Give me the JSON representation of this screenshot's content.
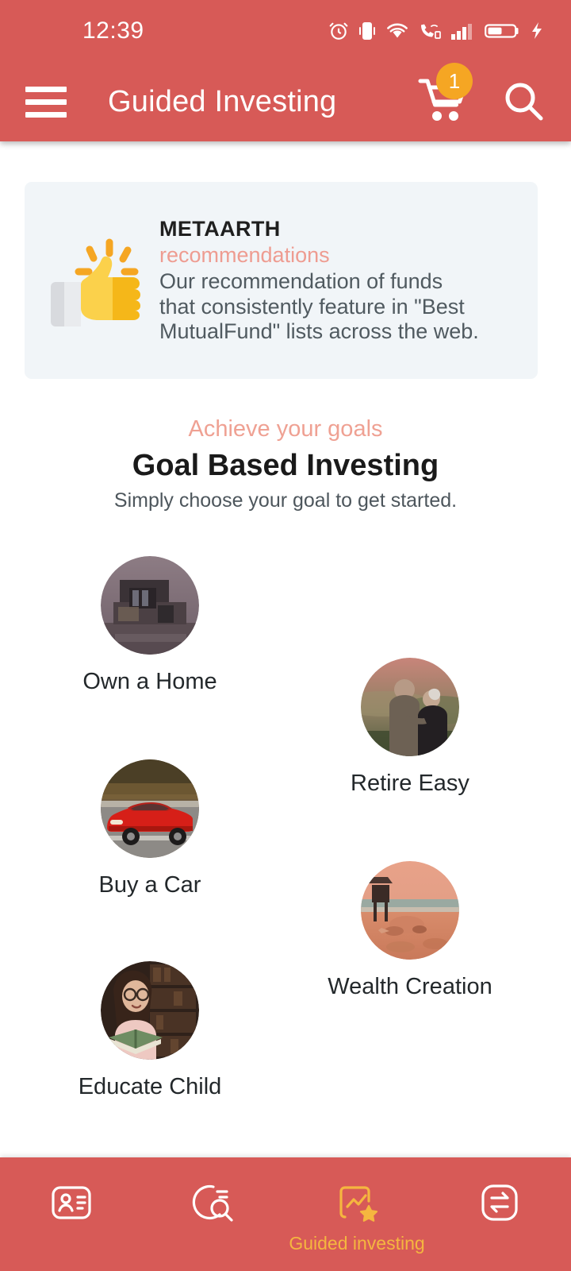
{
  "statusbar": {
    "time": "12:39",
    "icons": [
      "alarm-icon",
      "vibrate-icon",
      "wifi-icon",
      "wifi-calling-icon",
      "signal-bars-icon",
      "battery-icon",
      "charging-bolt-icon"
    ]
  },
  "appbar": {
    "menu_icon": "hamburger-menu-icon",
    "title": "Guided Investing",
    "cart_icon": "shopping-cart-icon",
    "cart_badge": "1",
    "search_icon": "search-icon",
    "background_color": "#d75a57"
  },
  "recommendation_card": {
    "icon": "thumbs-up-icon",
    "brand": "METAARTH",
    "subtitle": "recommendations",
    "description_lines": [
      "Our recommendation of funds",
      "that consistently feature in \"Best",
      "MutualFund\" lists across the web."
    ],
    "background_color": "#f1f5f8",
    "subtitle_color": "#ee9c91"
  },
  "goal_section": {
    "eyebrow": "Achieve your goals",
    "title": "Goal Based Investing",
    "caption": "Simply choose your goal to get started.",
    "eyebrow_color": "#efa193"
  },
  "goals": [
    {
      "label": "Own a Home",
      "image": "modern-house-icon"
    },
    {
      "label": "Retire Easy",
      "image": "elderly-couple-icon"
    },
    {
      "label": "Buy a Car",
      "image": "red-sports-car-icon"
    },
    {
      "label": "Wealth Creation",
      "image": "beach-sunset-icon"
    },
    {
      "label": "Educate Child",
      "image": "girl-reading-book-icon"
    }
  ],
  "bottom_nav": {
    "items": [
      {
        "label": "",
        "icon": "id-card-icon",
        "active": false
      },
      {
        "label": "",
        "icon": "explore-search-icon",
        "active": false
      },
      {
        "label": "Guided investing",
        "icon": "chart-star-icon",
        "active": true
      },
      {
        "label": "",
        "icon": "transfer-swap-icon",
        "active": false
      }
    ],
    "active_color": "#f5b63f",
    "background_color": "#d75a57"
  }
}
